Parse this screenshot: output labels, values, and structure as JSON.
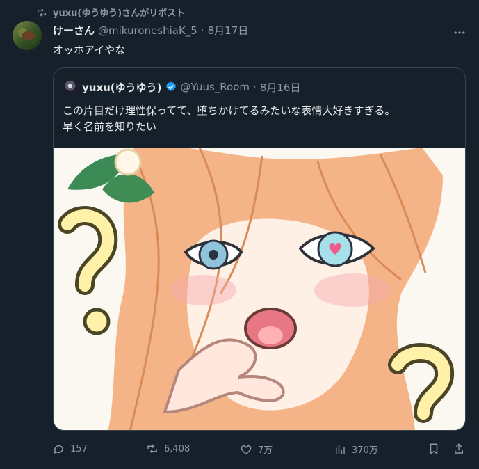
{
  "repost": {
    "text": "yuxu(ゆうゆう)さんがリポスト"
  },
  "post": {
    "display_name": "けーさん",
    "handle": "@mikuroneshiaK_5",
    "separator": "·",
    "date": "8月17日",
    "text": "オッホアイやな"
  },
  "quoted": {
    "display_name": "yuxu(ゆうゆう)",
    "handle": "@Yuus_Room",
    "separator": "·",
    "date": "8月16日",
    "text_line1": "この片目だけ理性保ってて、堕ちかけてるみたいな表情大好きすぎる。",
    "text_line2": "早く名前を知りたい"
  },
  "actions": {
    "replies": "157",
    "reposts": "6,408",
    "likes": "7万",
    "views": "370万"
  },
  "icons": {
    "repost": "repost-icon",
    "reply": "reply-icon",
    "like": "heart-icon",
    "views": "views-icon",
    "bookmark": "bookmark-icon",
    "share": "share-icon",
    "more": "more-icon",
    "verified": "verified-badge-icon"
  },
  "colors": {
    "background": "#15202b",
    "text": "#e7e9ea",
    "secondary": "#8b98a5",
    "border": "#38444d",
    "verified": "#1d9bf0"
  }
}
